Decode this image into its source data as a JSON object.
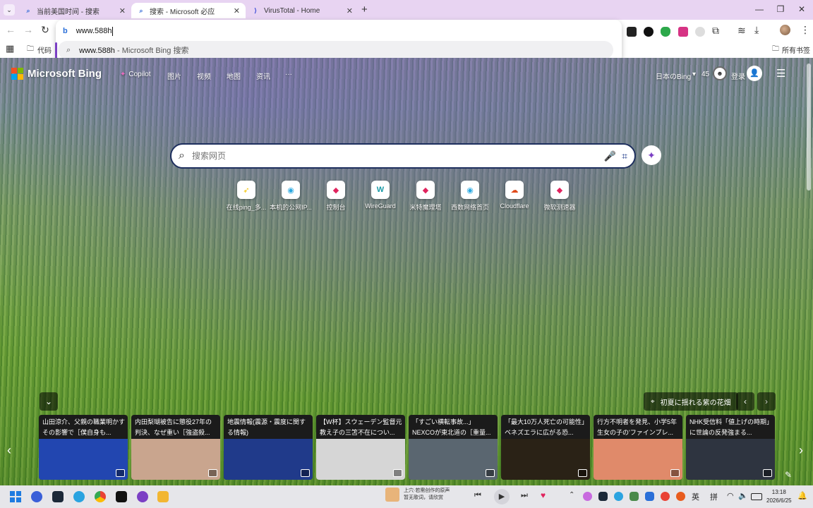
{
  "tabs": [
    {
      "title": "当前美国时间 - 搜索",
      "icon": "bing-icon",
      "active": false
    },
    {
      "title": "搜索 - Microsoft 必应",
      "icon": "bing-icon",
      "active": true
    },
    {
      "title": "VirusTotal - Home",
      "icon": "virustotal-icon",
      "active": false
    }
  ],
  "toolbar": {
    "address_value": "www.588h",
    "bookmark_folder": "代码",
    "all_bookmarks": "所有书签"
  },
  "omnibox": {
    "suggestion_query": "www.588h",
    "suggestion_suffix": " - Microsoft Bing 搜索"
  },
  "bing": {
    "logo_text": "Microsoft Bing",
    "nav": [
      "Copilot",
      "图片",
      "视频",
      "地图",
      "资讯",
      "···"
    ],
    "region": "日本のBing",
    "region_arrow": "▾",
    "rewards_points": "45",
    "signin": "登录",
    "search_placeholder": "搜索网页",
    "quick_links": [
      {
        "label": "在线ping_多...",
        "glyph": "➶",
        "color": "#f5c400"
      },
      {
        "label": "本机的公网IP...",
        "glyph": "◉",
        "color": "#2aa8e0"
      },
      {
        "label": "控制台",
        "glyph": "◆",
        "color": "#e0245e"
      },
      {
        "label": "WireGuard",
        "glyph": "W",
        "color": "#1a9aa6"
      },
      {
        "label": "米特魔理塔",
        "glyph": "◆",
        "color": "#e0245e"
      },
      {
        "label": "西数网络首页",
        "glyph": "◉",
        "color": "#2aa8e0"
      },
      {
        "label": "Cloudflare",
        "glyph": "☁",
        "color": "#e04a1a"
      },
      {
        "label": "微软测速器",
        "glyph": "◆",
        "color": "#e0245e"
      }
    ],
    "image_caption": "初夏に揺れる紫の花畑",
    "news": [
      {
        "text": "山田涼介、父親の職業明かすその影響で［僕自身も...",
        "img_color": "#2246b0"
      },
      {
        "text": "内田梨瑚被告に懲役27年の判決、なぜ重い［強盗殺...",
        "img_color": "#c9a58e"
      },
      {
        "text": "地震情報(震源・震度に関する情報)",
        "img_color": "#203a8a"
      },
      {
        "text": "【W杯】スウェーデン監督元教え子の三笘不在につい...",
        "img_color": "#d6d6d6"
      },
      {
        "text": "「すごい横転事故...」NEXCOが東北道の［重量...",
        "img_color": "#5a6670"
      },
      {
        "text": "「最大10万人死亡の可能性」ベネズエラに広がる恐...",
        "img_color": "#2a2216"
      },
      {
        "text": "行方不明者を発見、小学5年生女の子の'ファインプレ...",
        "img_color": "#e08a6a"
      },
      {
        "text": "NHK受信料「値上げの時期」に世論の反発強まる...",
        "img_color": "#2e3440"
      }
    ]
  },
  "taskbar": {
    "media_title": "上穴·若需创作的原声",
    "media_subtitle": "暂无歌词，请欣赏",
    "ime_lang": "英",
    "ime_mode": "拼",
    "time": "13:18",
    "date": "2026/6/25"
  },
  "colors": {
    "tabstrip": "#e8d4f2",
    "accent_purple": "#7b3fc4",
    "search_border": "#1e2f5e"
  }
}
